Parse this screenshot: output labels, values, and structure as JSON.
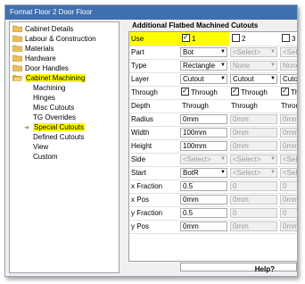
{
  "window": {
    "title": "Format Floor 2 Door Floor"
  },
  "sidebar": {
    "items": [
      {
        "label": "Cabinet Details",
        "type": "folder"
      },
      {
        "label": "Labour & Construction",
        "type": "folder"
      },
      {
        "label": "Materials",
        "type": "folder"
      },
      {
        "label": "Hardware",
        "type": "folder"
      },
      {
        "label": "Door Handles",
        "type": "folder"
      },
      {
        "label": "Cabinet Machining",
        "type": "folder-open",
        "highlight": true
      },
      {
        "label": "Machining",
        "type": "child"
      },
      {
        "label": "Hinges",
        "type": "child"
      },
      {
        "label": "Misc Cutouts",
        "type": "child"
      },
      {
        "label": "TG Overrides",
        "type": "child"
      },
      {
        "label": "Special Cutouts",
        "type": "child",
        "highlight": true,
        "current": true
      },
      {
        "label": "Defined Cutouts",
        "type": "child"
      },
      {
        "label": "View",
        "type": "child"
      },
      {
        "label": "Custom",
        "type": "child"
      }
    ]
  },
  "panel": {
    "title": "Additional Flatbed Machined Cutouts",
    "rows": {
      "use": {
        "label": "Use",
        "col1": "1",
        "col2": "2",
        "col3": "3"
      },
      "part": {
        "label": "Part",
        "col1": "Bot",
        "col2": "<Select>",
        "col3": "<Select>"
      },
      "type": {
        "label": "Type",
        "col1": "Rectangle",
        "col2": "None",
        "col3": "None"
      },
      "layer": {
        "label": "Layer",
        "col1": "Cutout",
        "col2": "Cutout",
        "col3": "Cutout"
      },
      "through": {
        "label": "Through",
        "col1": "Through",
        "col2": "Through",
        "col3": "Th"
      },
      "depth": {
        "label": "Depth",
        "col1": "Through",
        "col2": "Through",
        "col3": "Throu"
      },
      "radius": {
        "label": "Radius",
        "col1": "0mm",
        "col2": "0mm",
        "col3": "0mm"
      },
      "width": {
        "label": "Width",
        "col1": "100mm",
        "col2": "0mm",
        "col3": "0mm"
      },
      "height": {
        "label": "Height",
        "col1": "100mm",
        "col2": "0mm",
        "col3": "0mm"
      },
      "side": {
        "label": "Side",
        "col1": "<Select>",
        "col2": "<Select>",
        "col3": "<Sele"
      },
      "start": {
        "label": "Start",
        "col1": "BotR",
        "col2": "<Select>",
        "col3": "<Sele"
      },
      "x_fraction": {
        "label": "x Fraction",
        "col1": "0.5",
        "col2": "0",
        "col3": "0"
      },
      "x_pos": {
        "label": "x Pos",
        "col1": "0mm",
        "col2": "0mm",
        "col3": "0mm"
      },
      "y_fraction": {
        "label": "y Fraction",
        "col1": "0.5",
        "col2": "0",
        "col3": "0"
      },
      "y_pos": {
        "label": "y Pos",
        "col1": "0mm",
        "col2": "0mm",
        "col3": "0mm"
      }
    },
    "help_label": "Help?"
  },
  "colors": {
    "highlight": "#ffff00",
    "titlebar": "#3f6faf",
    "folder": "#e8c15a"
  }
}
